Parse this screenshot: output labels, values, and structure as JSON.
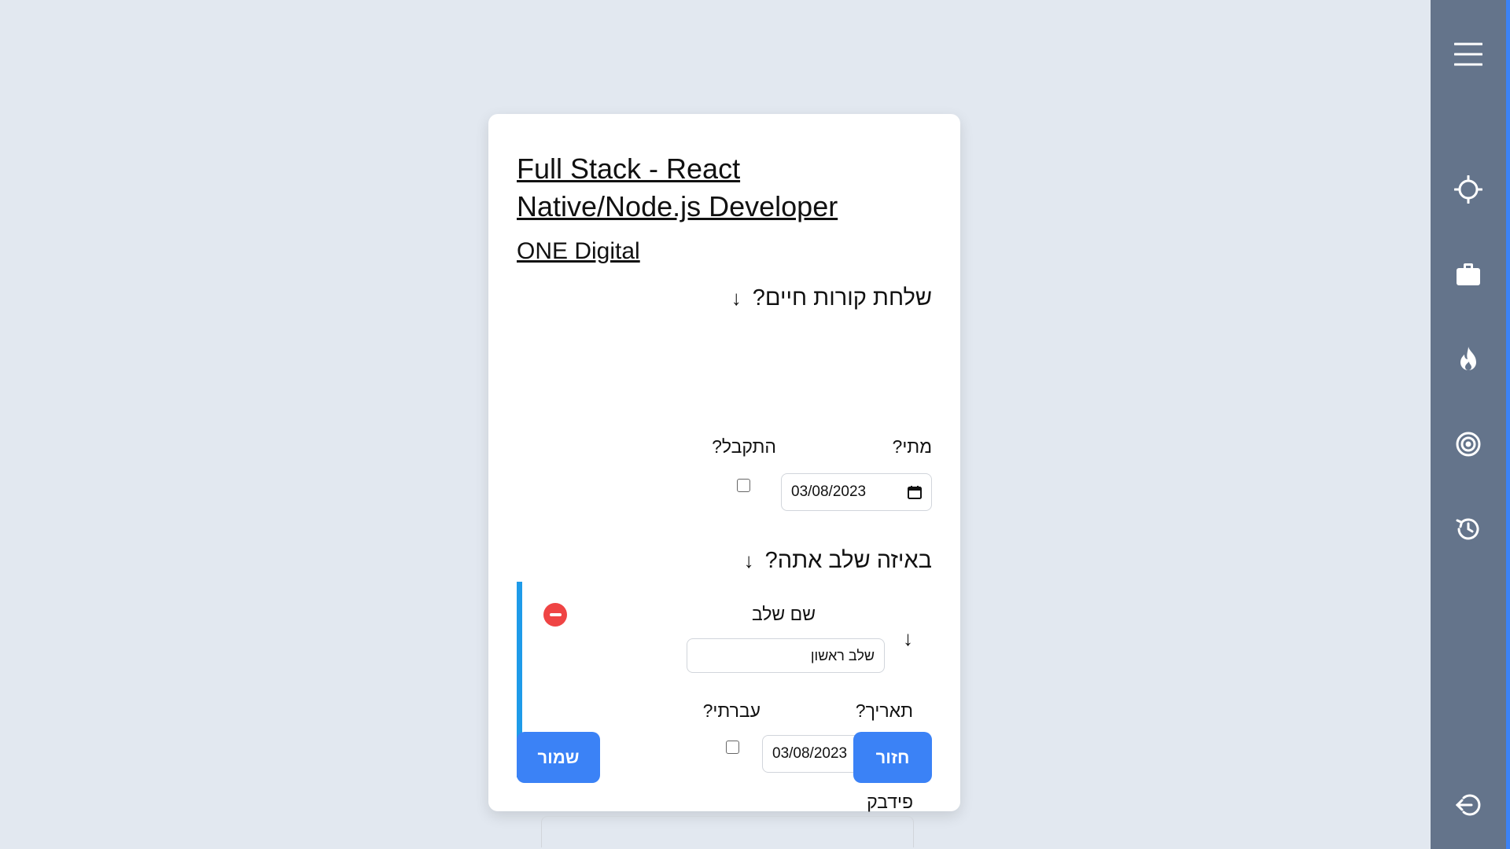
{
  "job": {
    "title": "Full Stack - React Native/Node.js Developer",
    "company": "ONE Digital"
  },
  "cv_section": {
    "heading": "שלחת קורות חיים?",
    "when_label": "מתי?",
    "accepted_label": "התקבל?",
    "date_value": "03/08/2023"
  },
  "stage_section": {
    "heading": "באיזה שלב אתה?",
    "stage_name_label": "שם שלב",
    "stage_name_value": "שלב ראשון",
    "date_label": "תאריך?",
    "passed_label": "עברתי?",
    "date_value": "03/08/2023",
    "feedback_label": "פידבק"
  },
  "buttons": {
    "save": "שמור",
    "back": "חזור"
  },
  "sidebar": {
    "icons": [
      "menu-icon",
      "crosshair-icon",
      "briefcase-icon",
      "flame-icon",
      "target-icon",
      "history-icon",
      "logout-icon"
    ]
  },
  "colors": {
    "background": "#e2e8f0",
    "sidebar": "#64748b",
    "primary": "#3b82f6",
    "stage_accent": "#1e9be9",
    "remove": "#ef4444"
  }
}
